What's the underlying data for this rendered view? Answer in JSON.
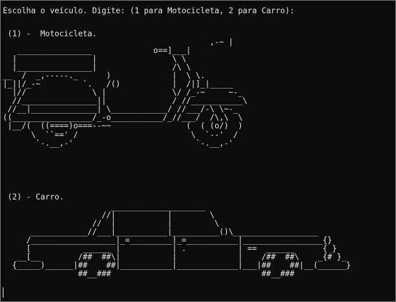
{
  "terminal": {
    "prompt": "Escolha o veículo. Digite: (1 para Motocicleta, 2 para Carro):",
    "option_moto": " (1) -  Motocicleta.",
    "option_car": " (2) - Carro."
  },
  "moto_art": "                                            ,-~ |\n   ________________             o==]___|\n  |                |                \\ \\\n  |________________|                /\\ \\\n__  /  _,-----._      )             |  \\ \\.\n|_||/_-~         `.   /()           |  /|]_|_____\n  |//              \\ |              \\/ /_-~     ~-_\n  //________________||              / //___________\\\n //__|______________| \\____________/ //___/-\\ \\~-_\n((_________________/_-o___________/_//___/  /\\,\\  \\\n |__/(  ((====)o===--~~                (  ( (o/)  )\n      \\  ``==' /                        \\  `--'  /\n       `-.__,-'                          `-.__,-'",
  "car_art": "                       ____________________\n                     //|           |        \\\n                   //  |           |         \\\n      ____________//___|___________|__________()\\__________________\n     /__________________|_=_________|_=___________|_________________{}\n     [           ______ |           | .           | ==  ______      { }\n   __[__        /##  ##\\|           |             |    /##  ##\\    _{# }_\n  {_____)______|##    ##|___________|_____________|___|##    ##|__(______}\n                ##__###                                ##__###"
}
